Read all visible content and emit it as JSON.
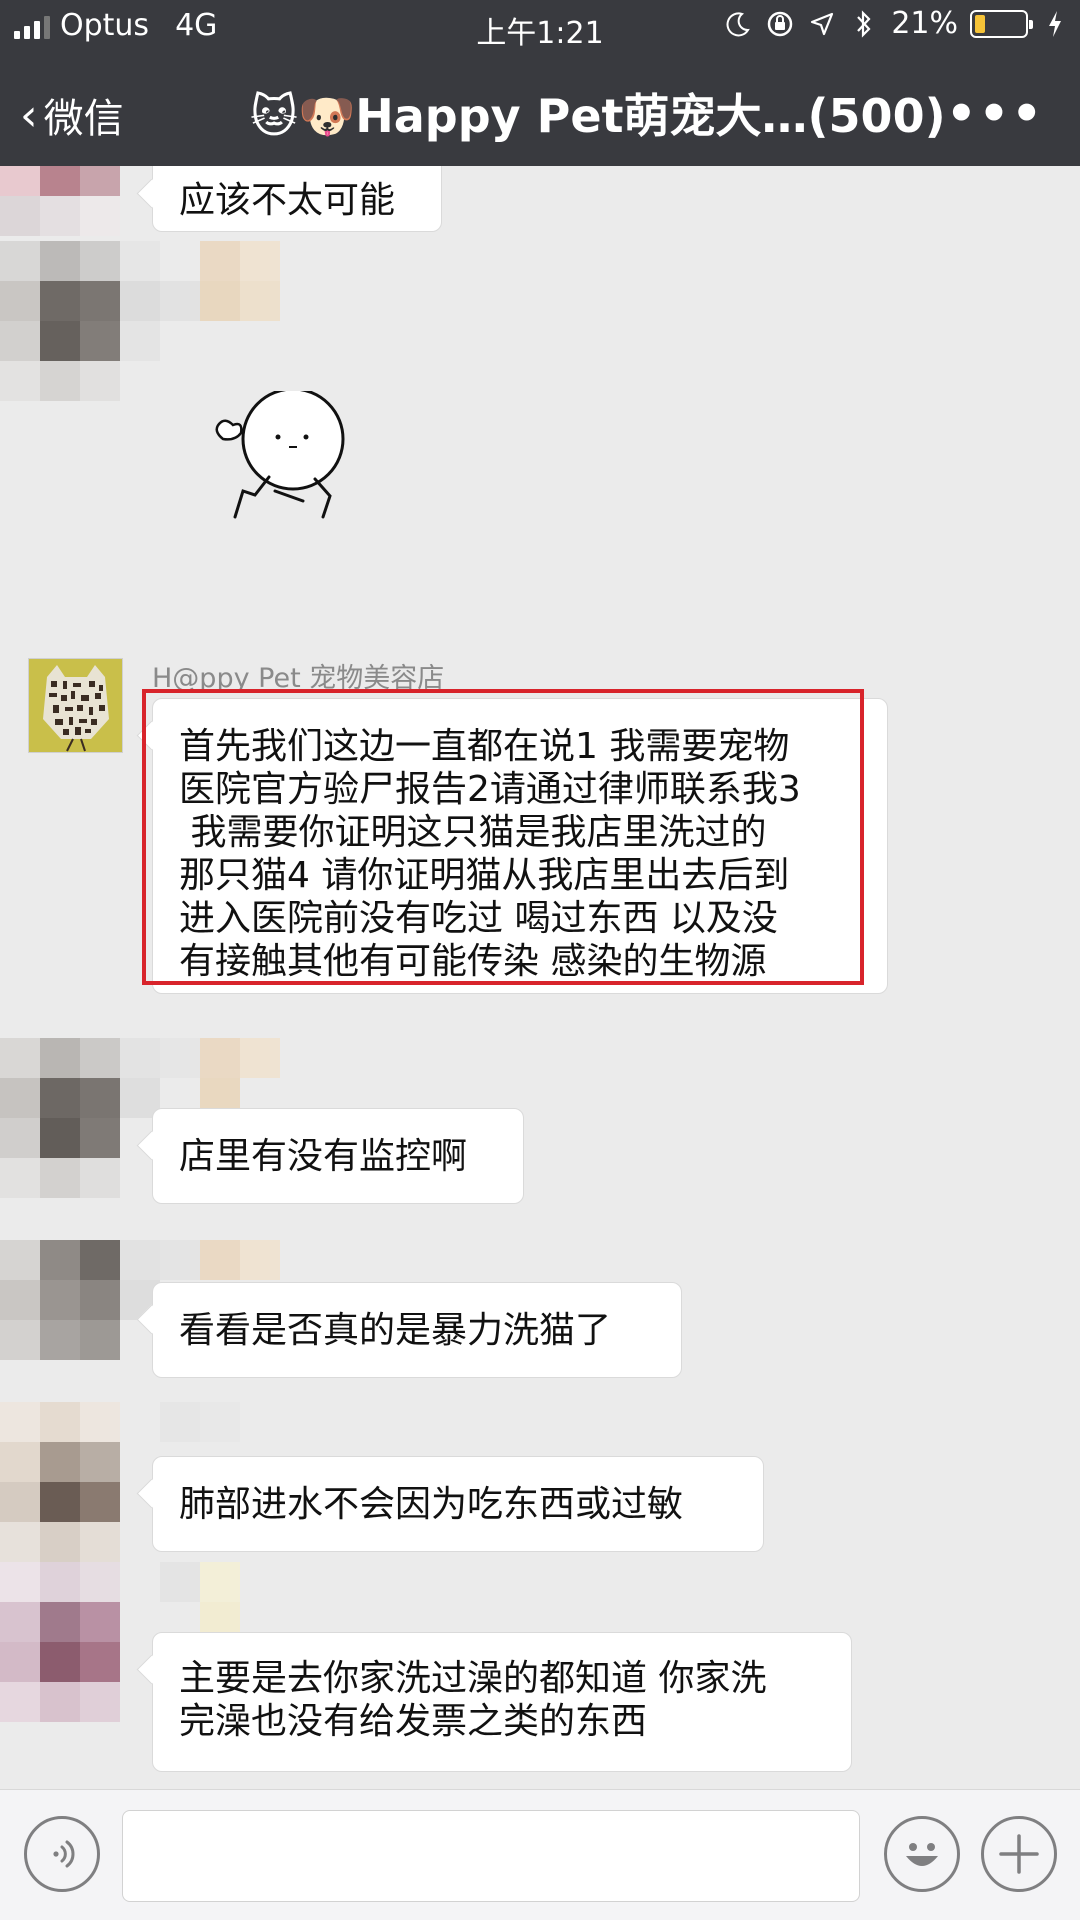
{
  "status_bar": {
    "carrier": "Optus",
    "network": "4G",
    "time": "上午1:21",
    "battery": "21%",
    "battery_level": 0.21
  },
  "nav": {
    "back_label": "微信",
    "title": "🐱🐶Happy Pet萌宠大…(500)",
    "more_icon": "more-dots-icon"
  },
  "messages": [
    {
      "text": "应该不太可能"
    },
    {
      "text": ""
    },
    {
      "sender": "H@ppy Pet 宠物美容店",
      "lines": [
        "首先我们这边一直都在说1 我需要宠物",
        "医院官方验尸报告2请通过律师联系我3",
        " 我需要你证明这只猫是我店里洗过的",
        "那只猫4 请你证明猫从我店里出去后到",
        "进入医院前没有吃过 喝过东西 以及没",
        "有接触其他有可能传染 感染的生物源"
      ]
    },
    {
      "text": "店里有没有监控啊"
    },
    {
      "text": "看看是否真的是暴力洗猫了"
    },
    {
      "text": "肺部进水不会因为吃东西或过敏"
    },
    {
      "lines": [
        "主要是去你家洗过澡的都知道 你家洗",
        "完澡也没有给发票之类的东西"
      ]
    }
  ],
  "input_bar": {
    "voice_icon": "voice-icon",
    "emoji_icon": "emoji-icon",
    "plus_icon": "plus-icon",
    "input_value": ""
  },
  "colors": {
    "header_bg": "#393a3f",
    "chat_bg": "#ebebeb",
    "highlight_border": "#d8242b",
    "battery_fill": "#f6c338"
  }
}
